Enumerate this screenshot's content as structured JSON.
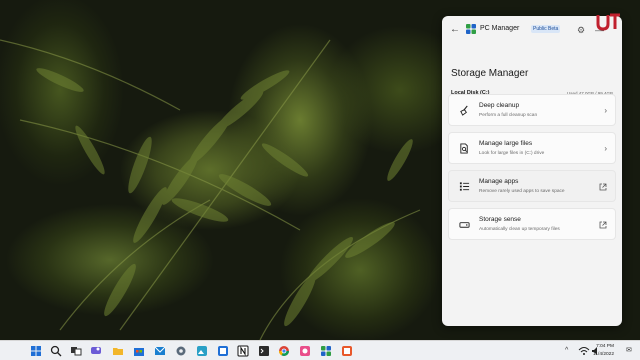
{
  "window": {
    "app_title": "PC Manager",
    "badge": "Public Beta",
    "icons": {
      "back": "back-arrow-icon",
      "settings": "gear-icon",
      "minimize": "minimize-icon"
    }
  },
  "page": {
    "title": "Storage Manager",
    "disk_label": "Local Disk (C:)",
    "disk_usage_text": "Used 47.0GB / 99.4GB",
    "disk_used_fraction": 0.473,
    "accent_color": "#1f64c8"
  },
  "items": [
    {
      "label": "Deep cleanup",
      "desc": "Perform a full cleanup scan",
      "icon": "broom-icon",
      "trail": "chevron-right-icon"
    },
    {
      "label": "Manage large files",
      "desc": "Look for large files in (C:) drive",
      "icon": "file-search-icon",
      "trail": "chevron-right-icon"
    },
    {
      "label": "Manage apps",
      "desc": "Remove rarely used apps to save space",
      "icon": "app-list-icon",
      "trail": "open-external-icon"
    },
    {
      "label": "Storage sense",
      "desc": "Automatically clean up temporary files",
      "icon": "drive-icon",
      "trail": "open-external-icon"
    }
  ],
  "taskbar": {
    "icons": [
      "start-icon",
      "search-icon",
      "task-view-icon",
      "chat-icon",
      "file-explorer-icon",
      "store-icon",
      "mail-icon",
      "settings-app-icon",
      "photos-icon",
      "notion-icon",
      "terminal-icon",
      "chrome-icon",
      "snip-icon",
      "pc-manager-icon",
      "app-icon"
    ],
    "tray_chevron": "^",
    "time": "7:04 PM",
    "date": "11/4/2022"
  }
}
